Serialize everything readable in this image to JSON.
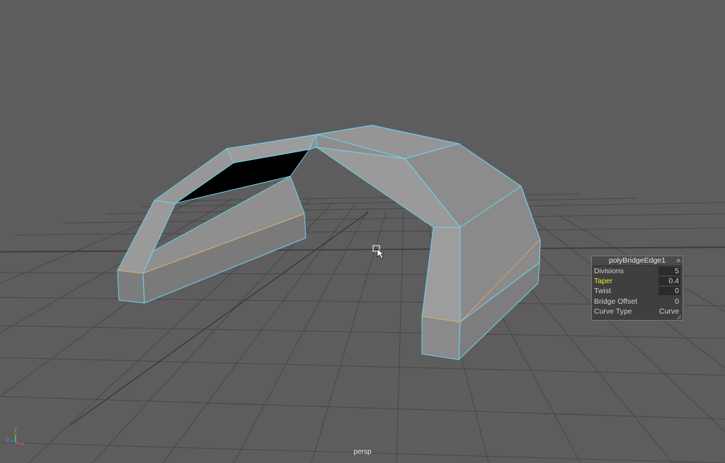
{
  "viewport": {
    "camera_name": "persp"
  },
  "axis": {
    "x_label": "x",
    "y_label": "y",
    "z_label": "z"
  },
  "inview_editor": {
    "title": "polyBridgeEdge1",
    "menu_icon": "menu-icon",
    "rows": [
      {
        "label": "Divisions",
        "value": "5"
      },
      {
        "label": "Taper",
        "value": "0.4"
      },
      {
        "label": "Twist",
        "value": "0"
      },
      {
        "label": "Bridge Offset",
        "value": "0"
      },
      {
        "label": "Curve Type",
        "value": "Curve"
      }
    ]
  },
  "colors": {
    "viewport_bg": "#5d5d5d",
    "grid_line": "#464646",
    "mesh_face": "#8a8a8a",
    "selection_edge": "#6ad4f0",
    "orange_edge": "#e0a060",
    "hole": "#000000",
    "highlight_label": "#e8e63a"
  },
  "cursor": "select-cursor-icon"
}
